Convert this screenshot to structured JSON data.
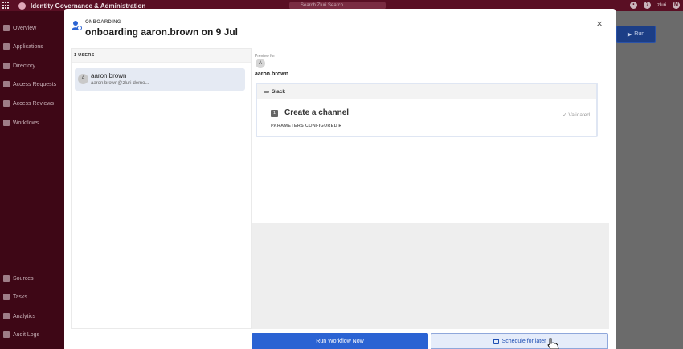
{
  "topbar": {
    "app_title": "Identity Governance & Administration",
    "search_placeholder": "Search Zluri Search",
    "org": "zluri",
    "avatar_initial": "M"
  },
  "sidebar": {
    "items": [
      {
        "label": "Overview",
        "icon": "grid-icon"
      },
      {
        "label": "Applications",
        "icon": "apps-icon"
      },
      {
        "label": "Directory",
        "icon": "directory-icon"
      },
      {
        "label": "Access Requests",
        "icon": "key-icon"
      },
      {
        "label": "Access Reviews",
        "icon": "shield-icon"
      },
      {
        "label": "Workflows",
        "icon": "bolt-icon"
      },
      {
        "label": "Sources",
        "icon": "database-icon"
      },
      {
        "label": "Tasks",
        "icon": "tasks-icon"
      },
      {
        "label": "Analytics",
        "icon": "chart-icon"
      },
      {
        "label": "Audit Logs",
        "icon": "log-icon"
      }
    ]
  },
  "background": {
    "run_label": "Run"
  },
  "modal": {
    "eyebrow": "ONBOARDING",
    "title": "onboarding aaron.brown on 9 Jul",
    "users_header": "1 USERS",
    "user": {
      "initial": "A",
      "name": "aaron.brown",
      "email": "aaron.brown@zluri-demo..."
    },
    "preview": {
      "label": "Preview for",
      "initial": "A",
      "name": "aaron.brown",
      "app_name": "Slack",
      "step_number": "1",
      "step_title": "Create a channel",
      "step_status": "Validated",
      "params_label": "PARAMETERS CONFIGURED"
    },
    "buttons": {
      "run_now": "Run Workflow Now",
      "schedule": "Schedule for later"
    }
  },
  "colors": {
    "topbar": "#5a0f24",
    "sidebar": "#3e0716",
    "primary": "#2b63d3"
  }
}
